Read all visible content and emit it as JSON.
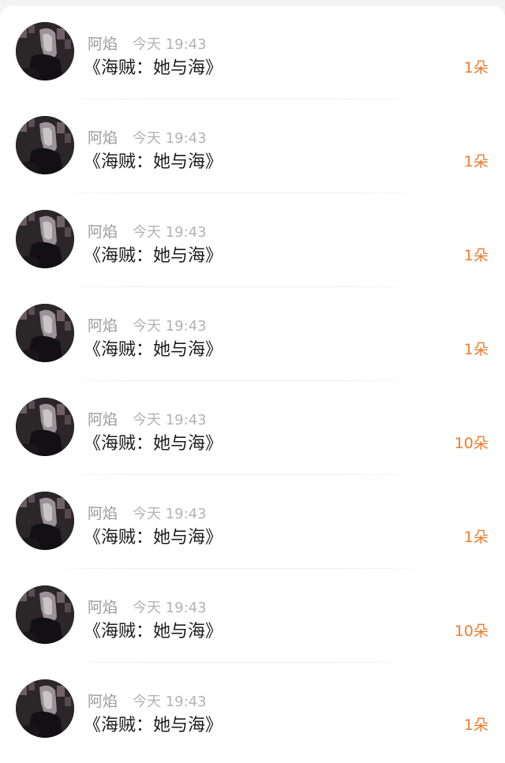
{
  "colors": {
    "background": "#f3f3f3",
    "card": "#ffffff",
    "name": "#9a9a9a",
    "time": "#b3b3b3",
    "title": "#1c1c1c",
    "gift_count": "#f07a2c"
  },
  "gift_list": {
    "items": [
      {
        "user": "阿焰",
        "time": "今天 19:43",
        "title": "《海贼：她与海》",
        "count": "1朵",
        "avatar_icon": "user-avatar"
      },
      {
        "user": "阿焰",
        "time": "今天 19:43",
        "title": "《海贼：她与海》",
        "count": "1朵",
        "avatar_icon": "user-avatar"
      },
      {
        "user": "阿焰",
        "time": "今天 19:43",
        "title": "《海贼：她与海》",
        "count": "1朵",
        "avatar_icon": "user-avatar"
      },
      {
        "user": "阿焰",
        "time": "今天 19:43",
        "title": "《海贼：她与海》",
        "count": "1朵",
        "avatar_icon": "user-avatar"
      },
      {
        "user": "阿焰",
        "time": "今天 19:43",
        "title": "《海贼：她与海》",
        "count": "10朵",
        "avatar_icon": "user-avatar"
      },
      {
        "user": "阿焰",
        "time": "今天 19:43",
        "title": "《海贼：她与海》",
        "count": "1朵",
        "avatar_icon": "user-avatar"
      },
      {
        "user": "阿焰",
        "time": "今天 19:43",
        "title": "《海贼：她与海》",
        "count": "10朵",
        "avatar_icon": "user-avatar"
      },
      {
        "user": "阿焰",
        "time": "今天 19:43",
        "title": "《海贼：她与海》",
        "count": "1朵",
        "avatar_icon": "user-avatar"
      }
    ]
  }
}
